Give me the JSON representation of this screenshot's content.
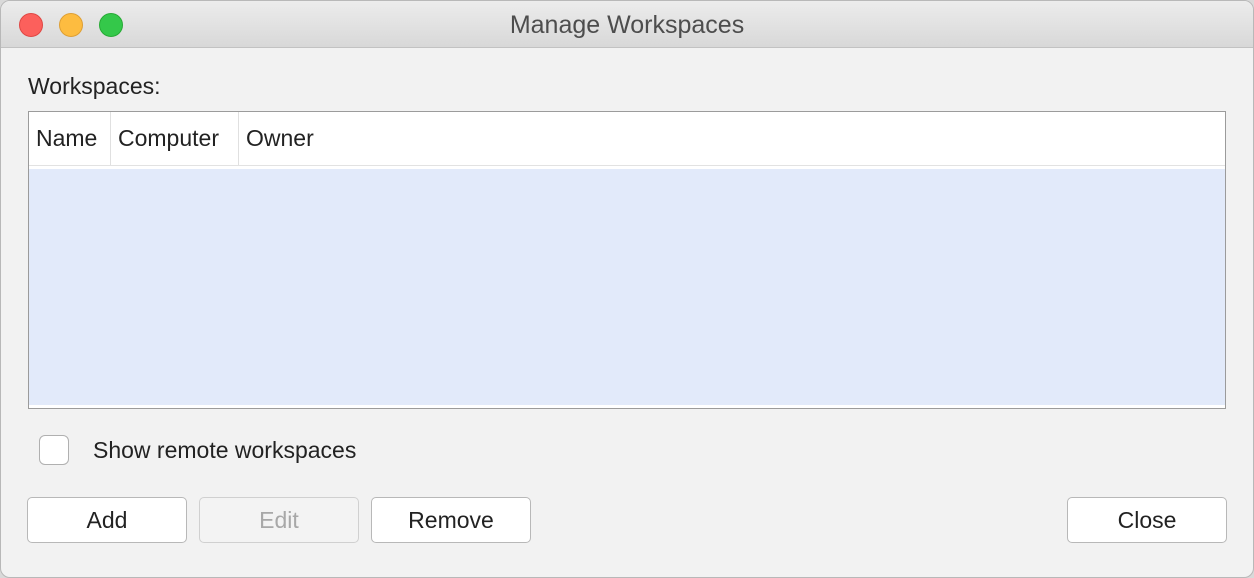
{
  "window": {
    "title": "Manage Workspaces"
  },
  "workspaces": {
    "label": "Workspaces:",
    "columns": [
      "Name",
      "Computer",
      "Owner"
    ],
    "rows": []
  },
  "options": {
    "show_remote_label": "Show remote workspaces",
    "show_remote_checked": false
  },
  "buttons": {
    "add": "Add",
    "edit": "Edit",
    "remove": "Remove",
    "close": "Close"
  },
  "colors": {
    "selection_bg": "#e2eafa",
    "close_light": "#fc605c",
    "minimize_light": "#fdbc40",
    "zoom_light": "#34c84a"
  }
}
